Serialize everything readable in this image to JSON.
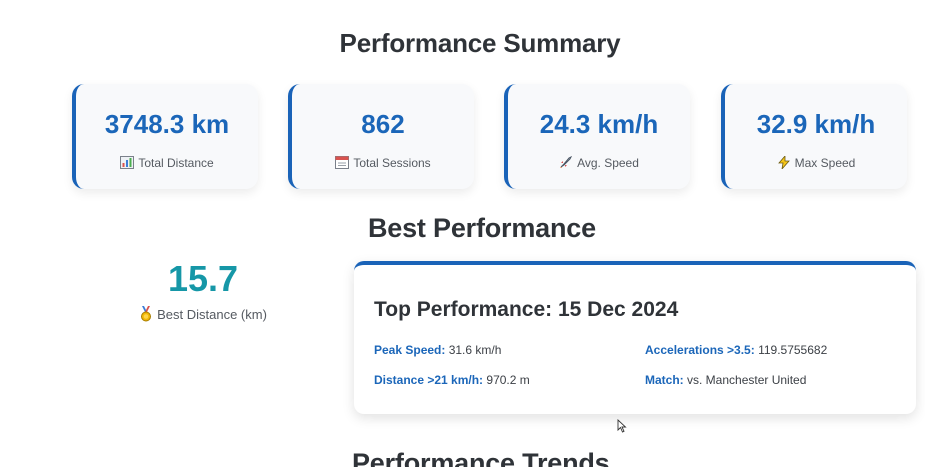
{
  "summary": {
    "title": "Performance Summary",
    "cards": [
      {
        "value": "3748.3 km",
        "label": "Total Distance",
        "icon": "bar-chart-icon"
      },
      {
        "value": "862",
        "label": "Total Sessions",
        "icon": "calendar-icon"
      },
      {
        "value": "24.3 km/h",
        "label": "Avg. Speed",
        "icon": "rocket-icon"
      },
      {
        "value": "32.9 km/h",
        "label": "Max Speed",
        "icon": "lightning-icon"
      }
    ]
  },
  "best": {
    "title": "Best Performance",
    "distance_value": "15.7",
    "distance_label": "Best Distance (km)",
    "distance_icon": "medal-icon",
    "top": {
      "heading": "Top Performance: 15 Dec 2024",
      "peak_speed_key": "Peak Speed:",
      "peak_speed_val": " 31.6 km/h",
      "distance_key": "Distance >21 km/h:",
      "distance_val": " 970.2 m",
      "accel_key": "Accelerations >3.5:",
      "accel_val": " 119.5755682",
      "match_key": "Match:",
      "match_val": " vs. Manchester United"
    }
  },
  "trends": {
    "title": "Performance Trends"
  },
  "colors": {
    "accent": "#1b66b9",
    "teal": "#1697a7",
    "text": "#2f3338"
  }
}
